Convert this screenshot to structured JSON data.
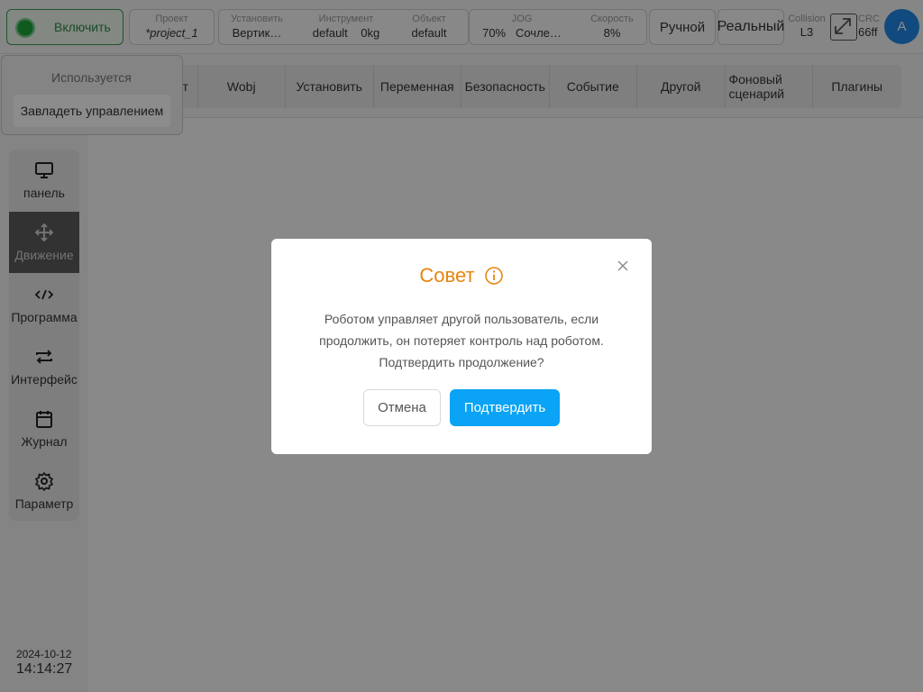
{
  "topbar": {
    "enable_label": "Включить",
    "project": {
      "label": "Проект",
      "value": "*project_1"
    },
    "install": {
      "label": "Установить",
      "value": "Вертик…"
    },
    "tool": {
      "label": "Инструмент",
      "value": "default",
      "payload": "0kg"
    },
    "object": {
      "label": "Объект",
      "value": "default"
    },
    "jog": {
      "label": "JOG",
      "percent": "70%",
      "mode": "Сочле…"
    },
    "speed": {
      "label": "Скорость",
      "value": "8%"
    },
    "manual_label": "Ручной",
    "real_label": "Реальный",
    "collision": {
      "label": "Collision",
      "value": "L3"
    },
    "crc": {
      "label": "CRC",
      "value": "66ff"
    },
    "avatar_letter": "A"
  },
  "tabs": [
    {
      "label": "Инструмент"
    },
    {
      "label": "Wobj"
    },
    {
      "label": "Установить"
    },
    {
      "label": "Переменная"
    },
    {
      "label": "Безопасность"
    },
    {
      "label": "Событие"
    },
    {
      "label": "Другой"
    },
    {
      "label": "Фоновый сценарий"
    },
    {
      "label": "Плагины"
    }
  ],
  "control": {
    "in_use_label": "Используется",
    "take_control_label": "Завладеть управлением"
  },
  "sidebar": {
    "items": [
      {
        "label": "панель",
        "icon": "monitor-icon"
      },
      {
        "label": "Движение",
        "icon": "move-icon",
        "active": true
      },
      {
        "label": "Программа",
        "icon": "code-icon"
      },
      {
        "label": "Интерфейс",
        "icon": "swap-icon"
      },
      {
        "label": "Журнал",
        "icon": "calendar-icon"
      },
      {
        "label": "Параметр",
        "icon": "gear-icon"
      }
    ],
    "date": "2024-10-12",
    "time": "14:14:27"
  },
  "modal": {
    "title": "Совет",
    "message": "Роботом управляет другой пользователь, если продолжить, он потеряет контроль над роботом. Подтвердить продолжение?",
    "cancel_label": "Отмена",
    "confirm_label": "Подтвердить"
  },
  "colors": {
    "accent": "#0aa3f5",
    "title": "#e8850f",
    "enable_green": "#1aa53a",
    "avatar_blue": "#1e88e5"
  }
}
